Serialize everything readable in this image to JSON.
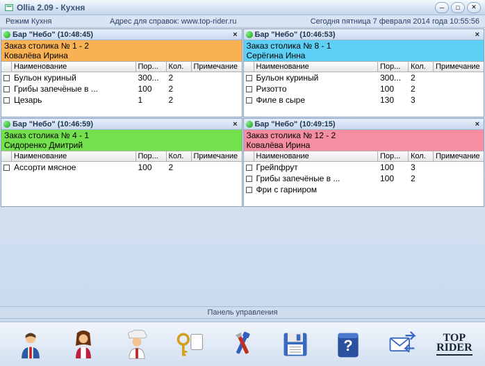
{
  "window": {
    "title": "Ollia 2.09  -  Кухня"
  },
  "infobar": {
    "mode": "Режим Кухня",
    "url": "Адрес для справок: www.top-rider.ru",
    "date": "Сегодня  пятница  7 февраля 2014 года  10:55:56"
  },
  "columns": {
    "name": "Наименование",
    "portion": "Пор...",
    "qty": "Кол.",
    "note": "Примечание"
  },
  "controlPanelLabel": "Панель управления",
  "logoTop": "TOP",
  "logoBottom": "RIDER",
  "panels": [
    {
      "title": "Бар \"Небо\"   (10:48:45)",
      "orderLine1": "Заказ столика № 1  -  2",
      "orderLine2": "Ковалёва Ирина",
      "color": "orange",
      "rows": [
        {
          "name": "Бульон куриный",
          "por": "300...",
          "qty": "2",
          "note": ""
        },
        {
          "name": "Грибы запечёные в ...",
          "por": "100",
          "qty": "2",
          "note": ""
        },
        {
          "name": "Цезарь",
          "por": "1",
          "qty": "2",
          "note": ""
        }
      ]
    },
    {
      "title": "Бар \"Небо\"   (10:46:53)",
      "orderLine1": "Заказ столика № 8  -  1",
      "orderLine2": "Серёгина Инна",
      "color": "cyan",
      "rows": [
        {
          "name": "Бульон куриный",
          "por": "300...",
          "qty": "2",
          "note": ""
        },
        {
          "name": "Ризотто",
          "por": "100",
          "qty": "2",
          "note": ""
        },
        {
          "name": "Филе в сыре",
          "por": "130",
          "qty": "3",
          "note": ""
        }
      ]
    },
    {
      "title": "Бар \"Небо\"   (10:46:59)",
      "orderLine1": "Заказ столика № 4  -  1",
      "orderLine2": "Сидоренко Дмитрий",
      "color": "green",
      "rows": [
        {
          "name": "Ассорти мясное",
          "por": "100",
          "qty": "2",
          "note": ""
        }
      ]
    },
    {
      "title": "Бар \"Небо\"   (10:49:15)",
      "orderLine1": "Заказ столика № 12  -  2",
      "orderLine2": "Ковалёва Ирина",
      "color": "pink",
      "rows": [
        {
          "name": "Грейпфрут",
          "por": "100",
          "qty": "3",
          "note": ""
        },
        {
          "name": "Грибы запечёные в ...",
          "por": "100",
          "qty": "2",
          "note": ""
        },
        {
          "name": "Фри с гарниром",
          "por": "",
          "qty": "",
          "note": ""
        }
      ]
    }
  ]
}
